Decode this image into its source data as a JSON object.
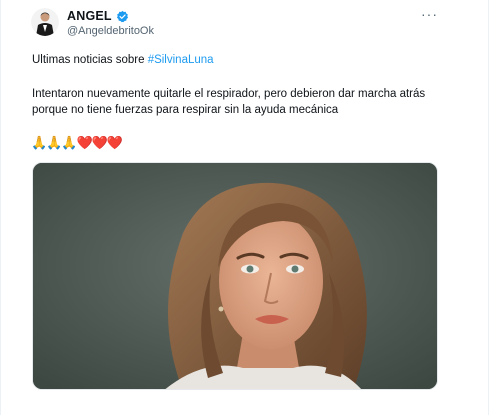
{
  "author": {
    "name": "ANGEL",
    "handle": "@AngeldebritoOk",
    "verified_color": "#1d9bf0",
    "avatar_icon": "man-in-black-suit-avatar"
  },
  "more_icon": "more-dots-icon",
  "more_glyph": "···",
  "tweet": {
    "line1_prefix": "Ultimas noticias sobre ",
    "hashtag": "#SilvinaLuna",
    "body": "Intentaron nuevamente quitarle el respirador, pero debieron dar marcha atrás porque no tiene fuerzas para respirar sin la ayuda mecánica",
    "emojis": "🙏🙏🙏❤️❤️❤️"
  },
  "media": {
    "description_icon": "portrait-photo",
    "colors": {
      "background": "#4f5a52",
      "hair": "#8a6242",
      "skin": "#e0a88a",
      "shirt": "#e8e4df"
    }
  }
}
